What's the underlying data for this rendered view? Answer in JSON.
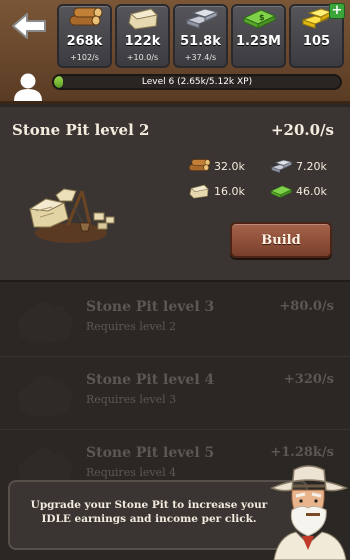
{
  "resources": [
    {
      "name": "wood",
      "value": "268k",
      "rate": "+102/s",
      "icon": "wood-logs-icon"
    },
    {
      "name": "stone",
      "value": "122k",
      "rate": "+10.0/s",
      "icon": "stone-block-icon"
    },
    {
      "name": "iron",
      "value": "51.8k",
      "rate": "+37.4/s",
      "icon": "iron-bars-icon"
    },
    {
      "name": "cash",
      "value": "1.23M",
      "rate": "",
      "icon": "cash-stack-icon"
    },
    {
      "name": "gold",
      "value": "105",
      "rate": "",
      "icon": "gold-bars-icon",
      "badge": "+"
    }
  ],
  "player": {
    "level_label": "Level 6 (2.65k/5.12k XP)",
    "xp_progress": 0.03
  },
  "active_building": {
    "title": "Stone Pit level 2",
    "rate": "+20.0/s",
    "costs": [
      {
        "resource": "wood",
        "value": "32.0k",
        "icon": "wood-logs-icon"
      },
      {
        "resource": "iron",
        "value": "7.20k",
        "icon": "iron-bars-icon"
      },
      {
        "resource": "stone",
        "value": "16.0k",
        "icon": "stone-block-icon"
      },
      {
        "resource": "cash",
        "value": "46.0k",
        "icon": "cash-stack-icon"
      }
    ],
    "build_label": "Build"
  },
  "locked_buildings": [
    {
      "title": "Stone Pit level 3",
      "rate": "+80.0/s",
      "requirement": "Requires level 2"
    },
    {
      "title": "Stone Pit level 4",
      "rate": "+320/s",
      "requirement": "Requires level 3"
    },
    {
      "title": "Stone Pit level 5",
      "rate": "+1.28k/s",
      "requirement": "Requires level 4"
    }
  ],
  "tip": {
    "text": "Upgrade your Stone Pit to increase your IDLE earnings and income per click."
  },
  "colors": {
    "topbar": "#6b4a2f",
    "card_bg": "#3a3532",
    "page_bg": "#2b2724",
    "build_button": "#8f5039",
    "xp_fill": "#7fc23a"
  }
}
